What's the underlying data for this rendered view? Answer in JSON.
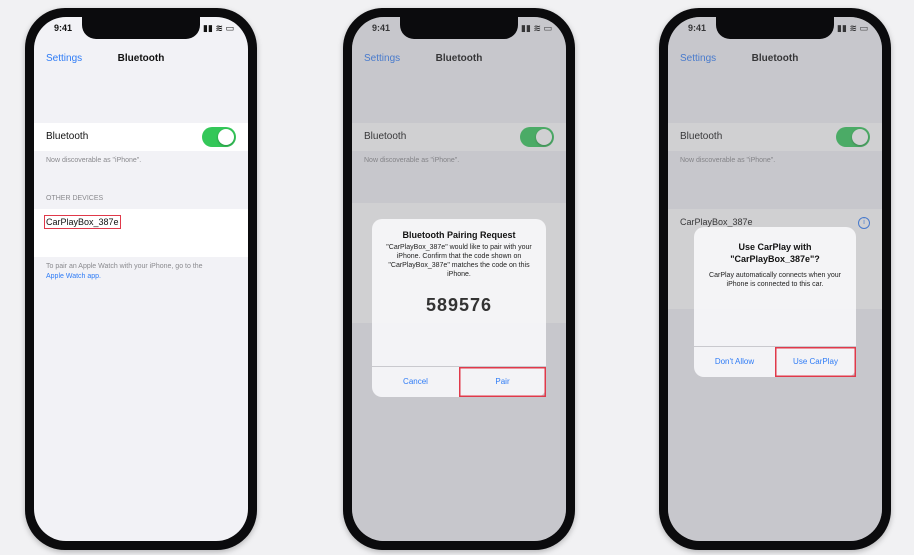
{
  "phone1": {
    "status_time": "9:41",
    "status_signal": "▮▮ ≋ ▭",
    "back_label": "Settings",
    "title": "Bluetooth",
    "bluetooth_label": "Bluetooth",
    "bluetooth_on": true,
    "discoverable_note": "Now discoverable as \"iPhone\".",
    "section_header": "OTHER DEVICES",
    "device_name": "CarPlayBox_387e",
    "pair_note": "To pair an Apple Watch with your iPhone, go to the",
    "pair_link": "Apple Watch app."
  },
  "phone2": {
    "status_time": "9:41",
    "status_signal": "▮▮ ≋ ▭",
    "back_label": "Settings",
    "title": "Bluetooth",
    "bluetooth_label": "Bluetooth",
    "bg_line": "Now discoverable as \"iPhone\".",
    "alert": {
      "title": "Bluetooth Pairing Request",
      "message": "\"CarPlayBox_387e\" would like to pair with your iPhone. Confirm that the code shown on \"CarPlayBox_387e\" matches the code on this iPhone.",
      "code": "589576",
      "cancel_label": "Cancel",
      "pair_label": "Pair"
    }
  },
  "phone3": {
    "status_time": "9:41",
    "status_signal": "▮▮ ≋ ▭",
    "back_label": "Settings",
    "title": "Bluetooth",
    "bluetooth_label": "Bluetooth",
    "bg_line": "Now discoverable as \"iPhone\".",
    "bg_device": "CarPlayBox_387e",
    "alert": {
      "title": "Use CarPlay with \"CarPlayBox_387e\"?",
      "message": "CarPlay automatically connects when your iPhone is connected to this car.",
      "left_label": "Don't Allow",
      "right_label": "Use CarPlay"
    }
  },
  "colors": {
    "accent": "#2f7cf6",
    "toggle_on": "#34c759",
    "highlight": "#e0394a"
  }
}
